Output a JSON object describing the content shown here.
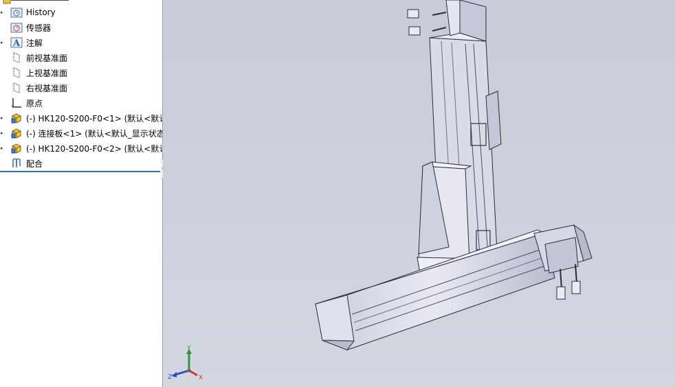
{
  "tree": {
    "items": [
      {
        "label": "History",
        "icon": "history-icon"
      },
      {
        "label": "传感器",
        "icon": "sensor-icon"
      },
      {
        "label": "注解",
        "icon": "annotation-icon"
      },
      {
        "label": "前视基准面",
        "icon": "plane-icon"
      },
      {
        "label": "上视基准面",
        "icon": "plane-icon"
      },
      {
        "label": "右视基准面",
        "icon": "plane-icon"
      },
      {
        "label": "原点",
        "icon": "origin-icon"
      },
      {
        "label": "(-) HK120-S200-F0<1> (默认<默认",
        "icon": "part-icon"
      },
      {
        "label": "(-) 连接板<1> (默认<默认_显示状态",
        "icon": "part-icon"
      },
      {
        "label": "(-) HK120-S200-F0<2> (默认<默认",
        "icon": "part-icon"
      },
      {
        "label": "配合",
        "icon": "mates-icon"
      }
    ]
  },
  "triad": {
    "x": "X",
    "y": "Y",
    "z": "Z"
  },
  "colors": {
    "tree_bg": "#ffffff",
    "viewport_bg": "#c8ccd8",
    "accent": "#2f6fc0",
    "part_body": "#dfe1ee"
  }
}
